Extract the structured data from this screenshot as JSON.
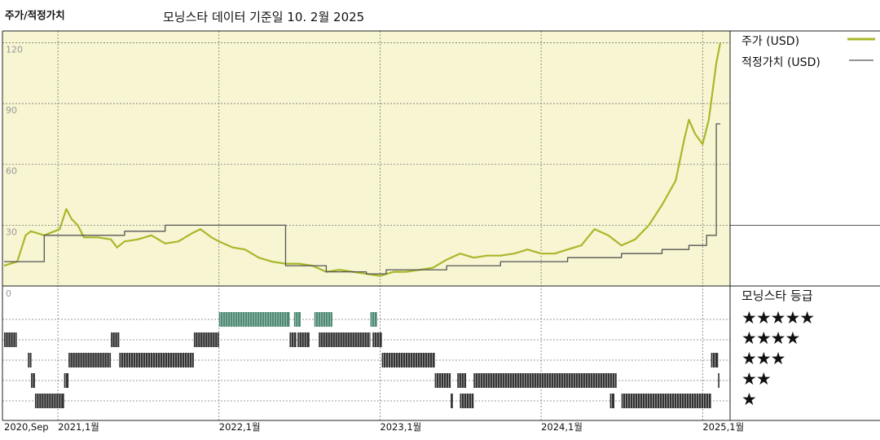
{
  "header": {
    "left_label": "주가/적정가치",
    "title": "모닝스타 데이터 기준일 10. 2월 2025"
  },
  "legend": {
    "price_label": "주가 (USD)",
    "price_color": "#a8b82a",
    "fair_label": "적정가치 (USD)",
    "fair_color": "#555555"
  },
  "rating_panel": {
    "title": "모닝스타 등급",
    "stars_5": "★★★★★",
    "stars_4": "★★★★",
    "stars_3": "★★★",
    "stars_2": "★★",
    "stars_1": "★"
  },
  "chart_data": {
    "type": "line",
    "title": "모닝스타 데이터 기준일 10. 2월 2025",
    "ylabel": "주가/적정가치",
    "ylim": [
      0,
      125
    ],
    "y_ticks": [
      "30",
      "60",
      "90",
      "120"
    ],
    "x_tick_labels": [
      "2020,Sep",
      "2021,1월",
      "2022,1월",
      "2023,1월",
      "2024,1월",
      "2025,1월"
    ],
    "rating_panel_zero_label": "0",
    "grid": true,
    "legend_position": "right",
    "background_color": "#f8f5d2",
    "series": [
      {
        "name": "주가 (USD)",
        "color": "#a8b82a",
        "points": [
          [
            "2020-09-01",
            10
          ],
          [
            "2020-10-01",
            12
          ],
          [
            "2020-10-20",
            25
          ],
          [
            "2020-11-01",
            27
          ],
          [
            "2020-12-01",
            25
          ],
          [
            "2021-01-05",
            28
          ],
          [
            "2021-01-20",
            38
          ],
          [
            "2021-02-01",
            33
          ],
          [
            "2021-02-15",
            30
          ],
          [
            "2021-03-01",
            24
          ],
          [
            "2021-04-01",
            24
          ],
          [
            "2021-05-01",
            23
          ],
          [
            "2021-05-15",
            19
          ],
          [
            "2021-06-01",
            22
          ],
          [
            "2021-07-01",
            23
          ],
          [
            "2021-08-01",
            25
          ],
          [
            "2021-09-01",
            21
          ],
          [
            "2021-10-01",
            22
          ],
          [
            "2021-11-01",
            26
          ],
          [
            "2021-11-20",
            28
          ],
          [
            "2021-12-15",
            24
          ],
          [
            "2022-01-01",
            22
          ],
          [
            "2022-02-01",
            19
          ],
          [
            "2022-03-01",
            18
          ],
          [
            "2022-04-01",
            14
          ],
          [
            "2022-05-01",
            12
          ],
          [
            "2022-06-01",
            11
          ],
          [
            "2022-07-01",
            11
          ],
          [
            "2022-08-01",
            10
          ],
          [
            "2022-09-01",
            7
          ],
          [
            "2022-10-01",
            8
          ],
          [
            "2022-11-01",
            7
          ],
          [
            "2022-12-01",
            6
          ],
          [
            "2023-01-01",
            5
          ],
          [
            "2023-02-01",
            7
          ],
          [
            "2023-03-01",
            7
          ],
          [
            "2023-04-01",
            8
          ],
          [
            "2023-05-01",
            9
          ],
          [
            "2023-06-01",
            13
          ],
          [
            "2023-07-01",
            16
          ],
          [
            "2023-08-01",
            14
          ],
          [
            "2023-09-01",
            15
          ],
          [
            "2023-10-01",
            15
          ],
          [
            "2023-11-01",
            16
          ],
          [
            "2023-12-01",
            18
          ],
          [
            "2024-01-01",
            16
          ],
          [
            "2024-02-01",
            16
          ],
          [
            "2024-03-01",
            18
          ],
          [
            "2024-04-01",
            20
          ],
          [
            "2024-05-01",
            28
          ],
          [
            "2024-06-01",
            25
          ],
          [
            "2024-07-01",
            20
          ],
          [
            "2024-08-01",
            23
          ],
          [
            "2024-09-01",
            30
          ],
          [
            "2024-10-01",
            40
          ],
          [
            "2024-11-01",
            52
          ],
          [
            "2024-11-20",
            72
          ],
          [
            "2024-12-01",
            82
          ],
          [
            "2024-12-15",
            75
          ],
          [
            "2025-01-01",
            70
          ],
          [
            "2025-01-15",
            82
          ],
          [
            "2025-02-01",
            110
          ],
          [
            "2025-02-10",
            120
          ]
        ]
      },
      {
        "name": "적정가치 (USD)",
        "color": "#555555",
        "points": [
          [
            "2020-09-01",
            12
          ],
          [
            "2020-12-01",
            12
          ],
          [
            "2020-12-01",
            25
          ],
          [
            "2021-06-01",
            25
          ],
          [
            "2021-06-01",
            27
          ],
          [
            "2021-09-01",
            27
          ],
          [
            "2021-09-01",
            30
          ],
          [
            "2022-06-01",
            30
          ],
          [
            "2022-06-01",
            10
          ],
          [
            "2022-09-01",
            10
          ],
          [
            "2022-09-01",
            7
          ],
          [
            "2022-12-01",
            7
          ],
          [
            "2022-12-01",
            6
          ],
          [
            "2023-01-15",
            6
          ],
          [
            "2023-01-15",
            8
          ],
          [
            "2023-06-01",
            8
          ],
          [
            "2023-06-01",
            10
          ],
          [
            "2023-10-01",
            10
          ],
          [
            "2023-10-01",
            12
          ],
          [
            "2024-03-01",
            12
          ],
          [
            "2024-03-01",
            14
          ],
          [
            "2024-07-01",
            14
          ],
          [
            "2024-07-01",
            16
          ],
          [
            "2024-10-01",
            16
          ],
          [
            "2024-10-01",
            18
          ],
          [
            "2024-12-01",
            18
          ],
          [
            "2024-12-01",
            20
          ],
          [
            "2025-01-10",
            20
          ],
          [
            "2025-01-10",
            25
          ],
          [
            "2025-02-01",
            25
          ],
          [
            "2025-02-01",
            80
          ],
          [
            "2025-02-10",
            80
          ]
        ]
      }
    ],
    "rating_history": [
      {
        "stars": 5,
        "color": "#4a8a72",
        "segments": [
          [
            "2022-01-01",
            "2022-06-10"
          ],
          [
            "2022-06-20",
            "2022-07-05"
          ],
          [
            "2022-08-05",
            "2022-09-15"
          ],
          [
            "2022-12-10",
            "2022-12-25"
          ]
        ]
      },
      {
        "stars": 4,
        "color": "#333333",
        "segments": [
          [
            "2020-09-01",
            "2020-09-30"
          ],
          [
            "2021-05-01",
            "2021-05-20"
          ],
          [
            "2021-11-05",
            "2022-01-01"
          ],
          [
            "2022-06-10",
            "2022-06-25"
          ],
          [
            "2022-06-28",
            "2022-07-25"
          ],
          [
            "2022-08-15",
            "2022-12-10"
          ],
          [
            "2022-12-15",
            "2023-01-05"
          ]
        ]
      },
      {
        "stars": 3,
        "color": "#333333",
        "segments": [
          [
            "2020-10-25",
            "2020-11-02"
          ],
          [
            "2021-01-25",
            "2021-05-01"
          ],
          [
            "2021-05-20",
            "2021-11-05"
          ],
          [
            "2023-01-05",
            "2023-05-05"
          ],
          [
            "2025-01-20",
            "2025-02-05"
          ]
        ]
      },
      {
        "stars": 2,
        "color": "#333333",
        "segments": [
          [
            "2020-11-01",
            "2020-11-10"
          ],
          [
            "2021-01-15",
            "2021-01-25"
          ],
          [
            "2023-05-05",
            "2023-06-10"
          ],
          [
            "2023-06-25",
            "2023-07-15"
          ],
          [
            "2023-08-01",
            "2024-06-20"
          ],
          [
            "2025-02-05",
            "2025-02-08"
          ]
        ]
      },
      {
        "stars": 1,
        "color": "#333333",
        "segments": [
          [
            "2020-11-10",
            "2021-01-15"
          ],
          [
            "2023-06-10",
            "2023-06-15"
          ],
          [
            "2023-07-01",
            "2023-08-01"
          ],
          [
            "2024-06-05",
            "2024-06-15"
          ],
          [
            "2024-07-01",
            "2025-01-20"
          ]
        ]
      }
    ]
  }
}
